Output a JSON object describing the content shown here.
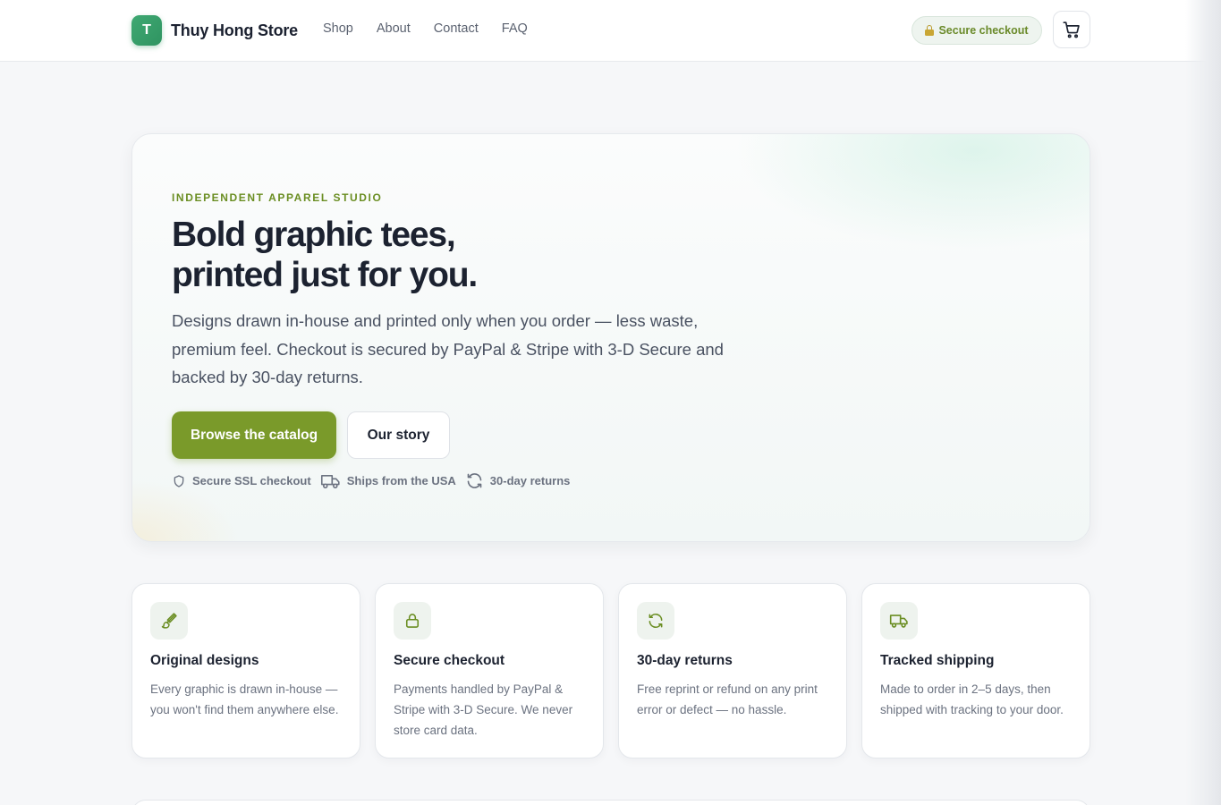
{
  "header": {
    "logo_letter": "T",
    "brand_name": "Thuy Hong Store",
    "nav": [
      "Shop",
      "About",
      "Contact",
      "FAQ"
    ],
    "secure_badge": "Secure checkout",
    "cart_icon": "cart-icon"
  },
  "hero": {
    "eyebrow": "INDEPENDENT APPAREL STUDIO",
    "title_line1": "Bold graphic tees,",
    "title_line2": "printed just for you.",
    "description": "Designs drawn in-house and printed only when you order — less waste, premium feel. Checkout is secured by PayPal & Stripe with 3-D Secure and backed by 30-day returns.",
    "primary_button": "Browse the catalog",
    "secondary_button": "Our story",
    "trust": [
      {
        "icon": "shield-icon",
        "label": "Secure SSL checkout"
      },
      {
        "icon": "truck-icon",
        "label": "Ships from the USA"
      },
      {
        "icon": "refresh-icon",
        "label": "30-day returns"
      }
    ]
  },
  "features": [
    {
      "icon": "brush-icon",
      "title": "Original designs",
      "text": "Every graphic is drawn in-house — you won't find them anywhere else."
    },
    {
      "icon": "lock-icon",
      "title": "Secure checkout",
      "text": "Payments handled by PayPal & Stripe with 3-D Secure. We never store card data."
    },
    {
      "icon": "refresh-icon",
      "title": "30-day returns",
      "text": "Free reprint or refund on any print error or defect — no hassle."
    },
    {
      "icon": "truck-icon",
      "title": "Tracked shipping",
      "text": "Made to order in 2–5 days, then shipped with tracking to your door."
    }
  ],
  "colors": {
    "accent": "#7a9a2a",
    "logo": "#3fa872",
    "eyebrow": "#6b8e23"
  }
}
